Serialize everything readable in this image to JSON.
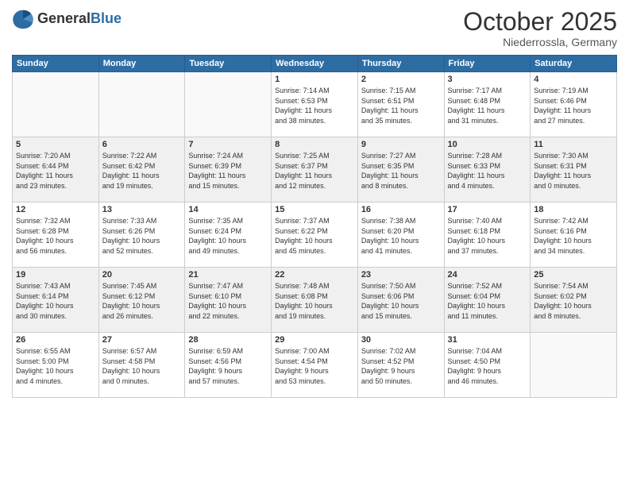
{
  "logo": {
    "general": "General",
    "blue": "Blue"
  },
  "header": {
    "month": "October 2025",
    "location": "Niederrossla, Germany"
  },
  "weekdays": [
    "Sunday",
    "Monday",
    "Tuesday",
    "Wednesday",
    "Thursday",
    "Friday",
    "Saturday"
  ],
  "weeks": [
    [
      {
        "num": "",
        "detail": ""
      },
      {
        "num": "",
        "detail": ""
      },
      {
        "num": "",
        "detail": ""
      },
      {
        "num": "1",
        "detail": "Sunrise: 7:14 AM\nSunset: 6:53 PM\nDaylight: 11 hours\nand 38 minutes."
      },
      {
        "num": "2",
        "detail": "Sunrise: 7:15 AM\nSunset: 6:51 PM\nDaylight: 11 hours\nand 35 minutes."
      },
      {
        "num": "3",
        "detail": "Sunrise: 7:17 AM\nSunset: 6:48 PM\nDaylight: 11 hours\nand 31 minutes."
      },
      {
        "num": "4",
        "detail": "Sunrise: 7:19 AM\nSunset: 6:46 PM\nDaylight: 11 hours\nand 27 minutes."
      }
    ],
    [
      {
        "num": "5",
        "detail": "Sunrise: 7:20 AM\nSunset: 6:44 PM\nDaylight: 11 hours\nand 23 minutes."
      },
      {
        "num": "6",
        "detail": "Sunrise: 7:22 AM\nSunset: 6:42 PM\nDaylight: 11 hours\nand 19 minutes."
      },
      {
        "num": "7",
        "detail": "Sunrise: 7:24 AM\nSunset: 6:39 PM\nDaylight: 11 hours\nand 15 minutes."
      },
      {
        "num": "8",
        "detail": "Sunrise: 7:25 AM\nSunset: 6:37 PM\nDaylight: 11 hours\nand 12 minutes."
      },
      {
        "num": "9",
        "detail": "Sunrise: 7:27 AM\nSunset: 6:35 PM\nDaylight: 11 hours\nand 8 minutes."
      },
      {
        "num": "10",
        "detail": "Sunrise: 7:28 AM\nSunset: 6:33 PM\nDaylight: 11 hours\nand 4 minutes."
      },
      {
        "num": "11",
        "detail": "Sunrise: 7:30 AM\nSunset: 6:31 PM\nDaylight: 11 hours\nand 0 minutes."
      }
    ],
    [
      {
        "num": "12",
        "detail": "Sunrise: 7:32 AM\nSunset: 6:28 PM\nDaylight: 10 hours\nand 56 minutes."
      },
      {
        "num": "13",
        "detail": "Sunrise: 7:33 AM\nSunset: 6:26 PM\nDaylight: 10 hours\nand 52 minutes."
      },
      {
        "num": "14",
        "detail": "Sunrise: 7:35 AM\nSunset: 6:24 PM\nDaylight: 10 hours\nand 49 minutes."
      },
      {
        "num": "15",
        "detail": "Sunrise: 7:37 AM\nSunset: 6:22 PM\nDaylight: 10 hours\nand 45 minutes."
      },
      {
        "num": "16",
        "detail": "Sunrise: 7:38 AM\nSunset: 6:20 PM\nDaylight: 10 hours\nand 41 minutes."
      },
      {
        "num": "17",
        "detail": "Sunrise: 7:40 AM\nSunset: 6:18 PM\nDaylight: 10 hours\nand 37 minutes."
      },
      {
        "num": "18",
        "detail": "Sunrise: 7:42 AM\nSunset: 6:16 PM\nDaylight: 10 hours\nand 34 minutes."
      }
    ],
    [
      {
        "num": "19",
        "detail": "Sunrise: 7:43 AM\nSunset: 6:14 PM\nDaylight: 10 hours\nand 30 minutes."
      },
      {
        "num": "20",
        "detail": "Sunrise: 7:45 AM\nSunset: 6:12 PM\nDaylight: 10 hours\nand 26 minutes."
      },
      {
        "num": "21",
        "detail": "Sunrise: 7:47 AM\nSunset: 6:10 PM\nDaylight: 10 hours\nand 22 minutes."
      },
      {
        "num": "22",
        "detail": "Sunrise: 7:48 AM\nSunset: 6:08 PM\nDaylight: 10 hours\nand 19 minutes."
      },
      {
        "num": "23",
        "detail": "Sunrise: 7:50 AM\nSunset: 6:06 PM\nDaylight: 10 hours\nand 15 minutes."
      },
      {
        "num": "24",
        "detail": "Sunrise: 7:52 AM\nSunset: 6:04 PM\nDaylight: 10 hours\nand 11 minutes."
      },
      {
        "num": "25",
        "detail": "Sunrise: 7:54 AM\nSunset: 6:02 PM\nDaylight: 10 hours\nand 8 minutes."
      }
    ],
    [
      {
        "num": "26",
        "detail": "Sunrise: 6:55 AM\nSunset: 5:00 PM\nDaylight: 10 hours\nand 4 minutes."
      },
      {
        "num": "27",
        "detail": "Sunrise: 6:57 AM\nSunset: 4:58 PM\nDaylight: 10 hours\nand 0 minutes."
      },
      {
        "num": "28",
        "detail": "Sunrise: 6:59 AM\nSunset: 4:56 PM\nDaylight: 9 hours\nand 57 minutes."
      },
      {
        "num": "29",
        "detail": "Sunrise: 7:00 AM\nSunset: 4:54 PM\nDaylight: 9 hours\nand 53 minutes."
      },
      {
        "num": "30",
        "detail": "Sunrise: 7:02 AM\nSunset: 4:52 PM\nDaylight: 9 hours\nand 50 minutes."
      },
      {
        "num": "31",
        "detail": "Sunrise: 7:04 AM\nSunset: 4:50 PM\nDaylight: 9 hours\nand 46 minutes."
      },
      {
        "num": "",
        "detail": ""
      }
    ]
  ]
}
